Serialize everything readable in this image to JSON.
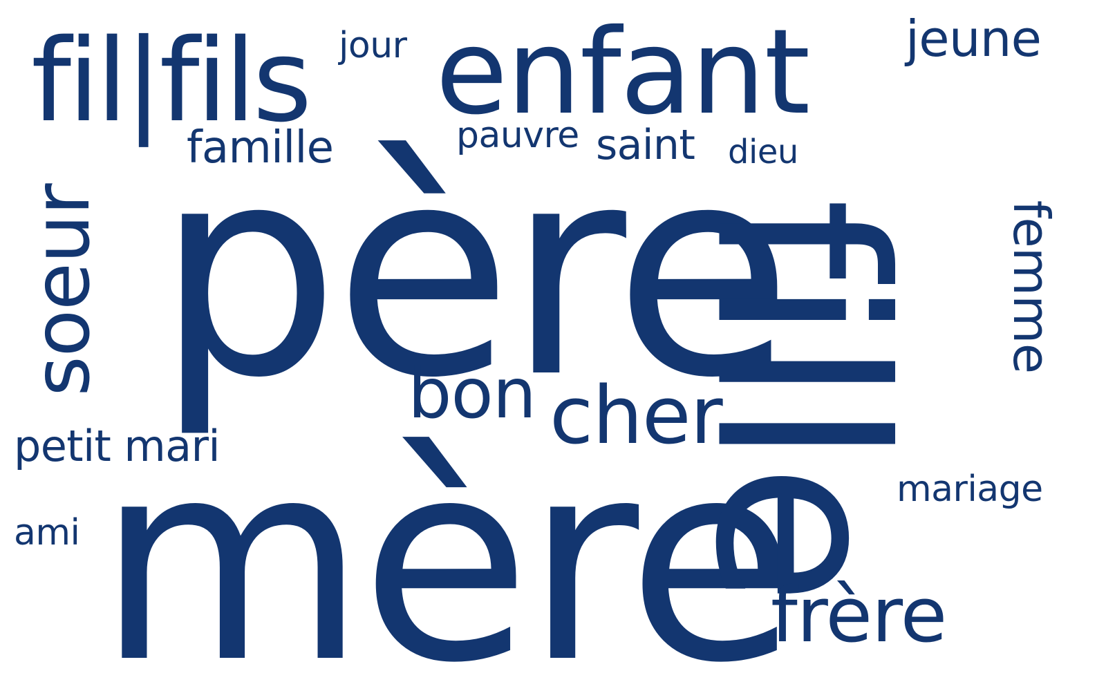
{
  "words": {
    "pere": "père",
    "mere": "mère",
    "fille": "fille",
    "enfant": "enfant",
    "filfils": "fil|fils",
    "soeur": "soeur",
    "cher": "cher",
    "bon": "bon",
    "frere": "frère",
    "jeune": "jeune",
    "femme": "femme",
    "famille": "famille",
    "jour": "jour",
    "pauvre": "pauvre",
    "saint": "saint",
    "dieu": "dieu",
    "petit_mari": "petit mari",
    "ami": "ami",
    "mariage": "mariage"
  },
  "colors": {
    "word": "#133670",
    "background": "#ffffff"
  }
}
